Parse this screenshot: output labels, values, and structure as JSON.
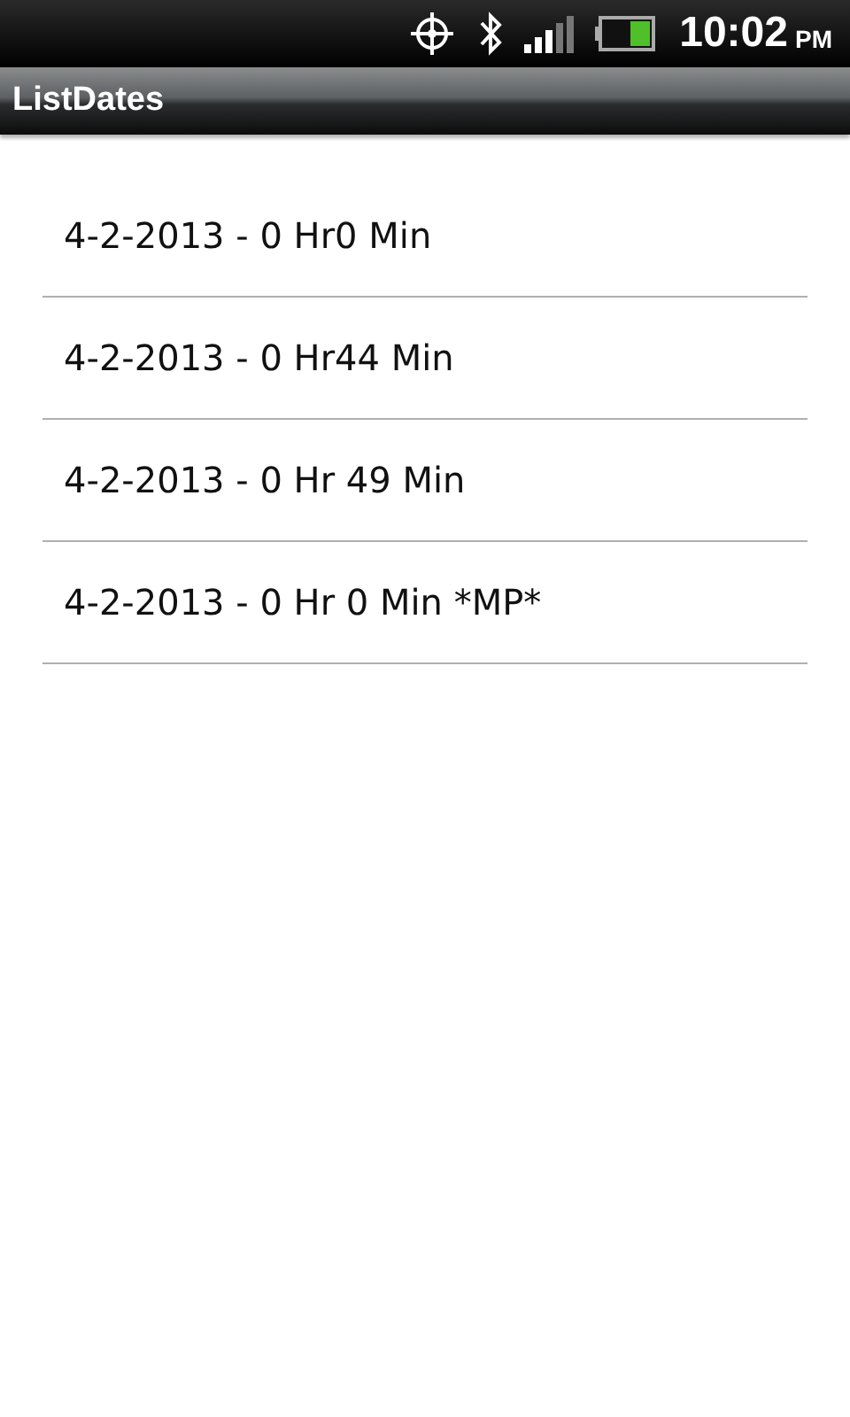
{
  "status_bar": {
    "time": "10:02",
    "meridiem": "PM"
  },
  "window": {
    "title": "ListDates"
  },
  "list": {
    "items": [
      {
        "label": "4-2-2013 - 0 Hr0 Min"
      },
      {
        "label": "4-2-2013 - 0 Hr44 Min"
      },
      {
        "label": "4-2-2013 - 0 Hr 49 Min"
      },
      {
        "label": "4-2-2013 - 0 Hr 0 Min *MP*"
      }
    ]
  }
}
